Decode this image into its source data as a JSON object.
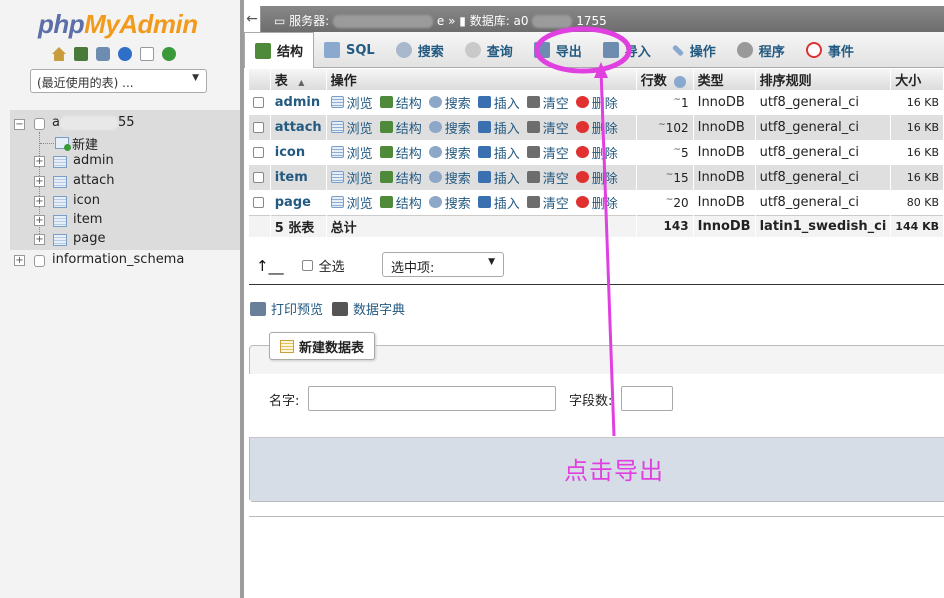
{
  "nav": {
    "logo_php": "php",
    "logo_myadmin": "MyAdmin",
    "recent_tables": "(最近使用的表) ...",
    "tree": {
      "db_name_prefix": "a",
      "db_name_suffix": "55",
      "new_label": "新建",
      "tables": [
        "admin",
        "attach",
        "icon",
        "item",
        "page"
      ],
      "other_db": "information_schema"
    }
  },
  "breadcrumb": {
    "server_label": "服务器:",
    "server_tail": "e »",
    "db_label": "数据库: a0",
    "db_tail": "1755"
  },
  "tabs": [
    {
      "label": "结构",
      "icon": "structure-icon"
    },
    {
      "label": "SQL",
      "icon": "sql-icon"
    },
    {
      "label": "搜索",
      "icon": "search-icon"
    },
    {
      "label": "查询",
      "icon": "query-icon"
    },
    {
      "label": "导出",
      "icon": "export-icon"
    },
    {
      "label": "导入",
      "icon": "import-icon"
    },
    {
      "label": "操作",
      "icon": "wrench-icon"
    },
    {
      "label": "程序",
      "icon": "routines-icon"
    },
    {
      "label": "事件",
      "icon": "events-icon"
    }
  ],
  "table": {
    "headers": {
      "table": "表",
      "sort_indicator": "▲",
      "action": "操作",
      "rows": "行数",
      "type": "类型",
      "collation": "排序规则",
      "size": "大小"
    },
    "actions": [
      "浏览",
      "结构",
      "搜索",
      "插入",
      "清空",
      "删除"
    ],
    "rows": [
      {
        "name": "admin",
        "rows": "1",
        "type": "InnoDB",
        "collation": "utf8_general_ci",
        "size": "16 KB"
      },
      {
        "name": "attach",
        "rows": "102",
        "type": "InnoDB",
        "collation": "utf8_general_ci",
        "size": "16 KB"
      },
      {
        "name": "icon",
        "rows": "5",
        "type": "InnoDB",
        "collation": "utf8_general_ci",
        "size": "16 KB"
      },
      {
        "name": "item",
        "rows": "15",
        "type": "InnoDB",
        "collation": "utf8_general_ci",
        "size": "16 KB"
      },
      {
        "name": "page",
        "rows": "20",
        "type": "InnoDB",
        "collation": "utf8_general_ci",
        "size": "80 KB"
      }
    ],
    "approx_mark": "~",
    "summary": {
      "count": "5 张表",
      "label": "总计",
      "rows": "143",
      "type": "InnoDB",
      "collation": "latin1_swedish_ci",
      "size": "144 KB"
    }
  },
  "bulk": {
    "check_all": "全选",
    "with_selected": "选中项:"
  },
  "links": {
    "print_view": "打印预览",
    "data_dictionary": "数据字典"
  },
  "create_table": {
    "legend": "新建数据表",
    "name_label": "名字:",
    "fields_label": "字段数:",
    "name_value": "",
    "fields_value": ""
  },
  "annotation": {
    "text": "点击导出",
    "color": "#e040e0"
  }
}
